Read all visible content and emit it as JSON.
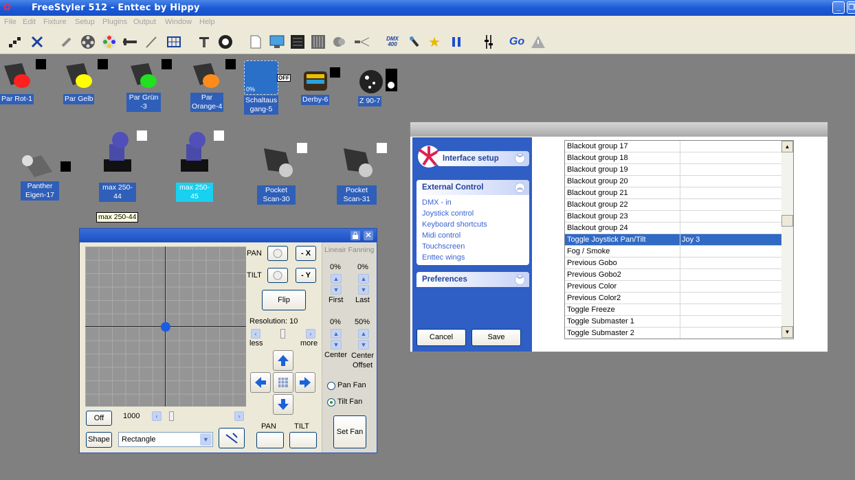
{
  "window": {
    "title": "FreeStyler 512 - Enttec by Hippy",
    "minimize": "_",
    "restore": "❐"
  },
  "menu": [
    "File",
    "Edit",
    "Fixture",
    "Setup",
    "Plugins",
    "Output",
    "Window",
    "Help"
  ],
  "toolbar": {
    "dmx_label": "DMX\n400",
    "go_label": "Go"
  },
  "fixtures": [
    {
      "label": "Par Rot-1",
      "color": "#ff2020"
    },
    {
      "label": "Par Gelb",
      "color": "#ffff00"
    },
    {
      "label": "Par Grün\n-3",
      "color": "#20e020"
    },
    {
      "label": "Par\nOrange-4",
      "color": "#ff8c1a"
    },
    {
      "label": "Schaltaus\ngang-5",
      "badge": "OFF",
      "pct": "0%"
    },
    {
      "label": "Derby-6"
    },
    {
      "label": "Z 90-7"
    },
    {
      "label": "Panther\nEigen-17"
    },
    {
      "label": "max 250-\n44"
    },
    {
      "label": "max 250-\n45"
    },
    {
      "label": "Pocket\nScan-30"
    },
    {
      "label": "Pocket\nScan-31"
    }
  ],
  "tooltip": "max 250-44",
  "joystick": {
    "pan": "PAN",
    "tilt": "TILT",
    "neg_x": "- X",
    "neg_y": "- Y",
    "flip": "Flip",
    "resolution": "Resolution: 10",
    "less": "less",
    "more": "more",
    "off": "Off",
    "speed": "1000",
    "shape": "Shape",
    "shape_value": "Rectangle",
    "pan_bottom": "PAN",
    "tilt_bottom": "TILT",
    "linear_fanning": "Lineair Fanning",
    "first_pct": "0%",
    "last_pct": "0%",
    "first": "First",
    "last": "Last",
    "center_pct": "0%",
    "offset_pct": "50%",
    "center": "Center",
    "center_offset": "Center\nOffset",
    "pan_fan": "Pan Fan",
    "tilt_fan": "Tilt Fan",
    "set_fan": "Set Fan",
    "position": {
      "pan_fraction": 0.5,
      "tilt_fraction": 0.5
    }
  },
  "interface": {
    "setup_title": "Interface setup",
    "external_title": "External Control",
    "links": [
      "DMX - in",
      "Joystick control",
      "Keyboard shortcuts",
      "Midi control",
      "Touchscreen",
      "Enttec wings"
    ],
    "preferences": "Preferences",
    "cancel": "Cancel",
    "save": "Save",
    "rows": [
      [
        "Blackout group 17",
        ""
      ],
      [
        "Blackout group 18",
        ""
      ],
      [
        "Blackout group 19",
        ""
      ],
      [
        "Blackout group 20",
        ""
      ],
      [
        "Blackout group 21",
        ""
      ],
      [
        "Blackout group 22",
        ""
      ],
      [
        "Blackout group 23",
        ""
      ],
      [
        "Blackout group 24",
        ""
      ],
      [
        "Toggle Joystick Pan/Tilt",
        "Joy 3"
      ],
      [
        "Fog / Smoke",
        ""
      ],
      [
        "Previous Gobo",
        ""
      ],
      [
        "Previous Gobo2",
        ""
      ],
      [
        "Previous Color",
        ""
      ],
      [
        "Previous Color2",
        ""
      ],
      [
        "Toggle Freeze",
        ""
      ],
      [
        "Toggle Submaster 1",
        ""
      ],
      [
        "Toggle Submaster 2",
        ""
      ]
    ],
    "selected_row": 8
  },
  "colors": {
    "desktop": "#808080",
    "titlebar": "#1c5ad6",
    "selection": "#316ac5",
    "label": "#2f5fb8"
  }
}
